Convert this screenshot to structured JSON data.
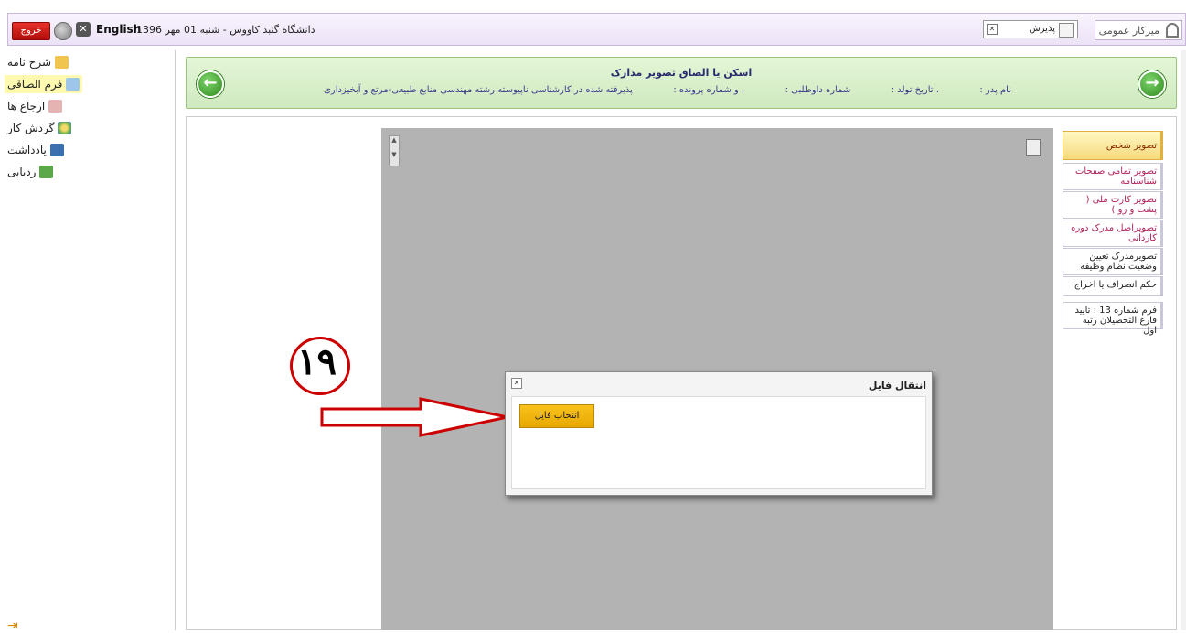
{
  "topbar": {
    "logout_label": "خروج",
    "language": "English",
    "date_text": "دانشگاه گنبد کاووس - شنبه 01 مهر 1396",
    "search_label": "پذیرش",
    "dashboard_label": "میزکار عمومی"
  },
  "sidebar": {
    "items": [
      {
        "label": "شرح نامه"
      },
      {
        "label": "فرم الصاقی"
      },
      {
        "label": "ارجاع ها"
      },
      {
        "label": "گردش کار"
      },
      {
        "label": "یادداشت"
      },
      {
        "label": "ردیابی"
      }
    ]
  },
  "header": {
    "title": "اسکن یا الصاق تصویر مدارک",
    "father_name": "نام پدر :",
    "birth_date": "، تاریخ تولد :",
    "applicant_no": "شماره داوطلبی :",
    "file_no": "، و شماره پرونده :",
    "program": "پذیرفته شده در کارشناسی ناپیوسته رشته مهندسی منابع طبیعی-مرتع و آبخیزداری"
  },
  "tabs": [
    {
      "label": "تصویر شخص"
    },
    {
      "label": "تصویر تمامی صفحات شناسنامه"
    },
    {
      "label": "تصویر کارت ملی ( پشت و رو )"
    },
    {
      "label": "تصویراصل مدرک دوره کاردانی"
    },
    {
      "label": "تصویرمدرک تعیین وضعیت نظام وظیفه"
    },
    {
      "label": "حکم انصراف یا اخراج"
    },
    {
      "label": "فرم شماره 13 : تایید فارغ التحصیلان رتبه اول"
    }
  ],
  "dialog": {
    "title": "انتقال فایل",
    "choose_file": "انتخاب فایل"
  },
  "annotation": {
    "number": "۱۹"
  }
}
